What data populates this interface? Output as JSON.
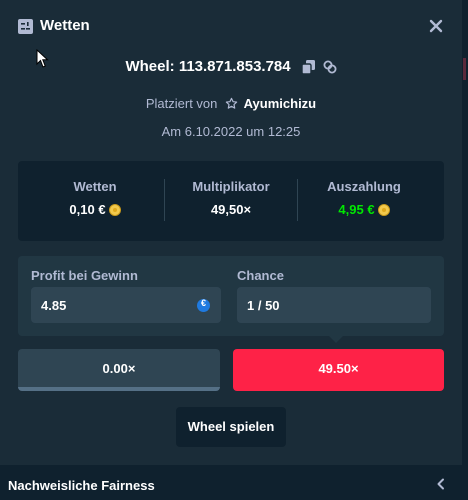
{
  "header": {
    "title": "Wetten",
    "title_icon": "bet-slip-icon",
    "close_icon": "close-icon"
  },
  "bet": {
    "id_label": "Wheel: 113.871.853.784",
    "placed_by_prefix": "Platziert von",
    "user": "Ayumichizu",
    "date": "Am 6.10.2022 um 12:25"
  },
  "stats": {
    "bet_label": "Wetten",
    "bet_value": "0,10 €",
    "multiplier_label": "Multiplikator",
    "multiplier_value": "49,50×",
    "payout_label": "Auszahlung",
    "payout_value": "4,95 €"
  },
  "inputs": {
    "profit_label": "Profit bei Gewinn",
    "profit_value": "4.85",
    "chance_label": "Chance",
    "chance_value": "1 / 50"
  },
  "segments": {
    "left_label": "0.00×",
    "right_label": "49.50×"
  },
  "play_button": "Wheel spielen",
  "footer": {
    "label": "Nachweisliche Fairness"
  },
  "colors": {
    "background": "#1a2c38",
    "panel_dark": "#0f212e",
    "panel_mid": "#213743",
    "field": "#2f4553",
    "muted_text": "#b1bad3",
    "win_green": "#00e701",
    "accent_red": "#fe2247"
  }
}
